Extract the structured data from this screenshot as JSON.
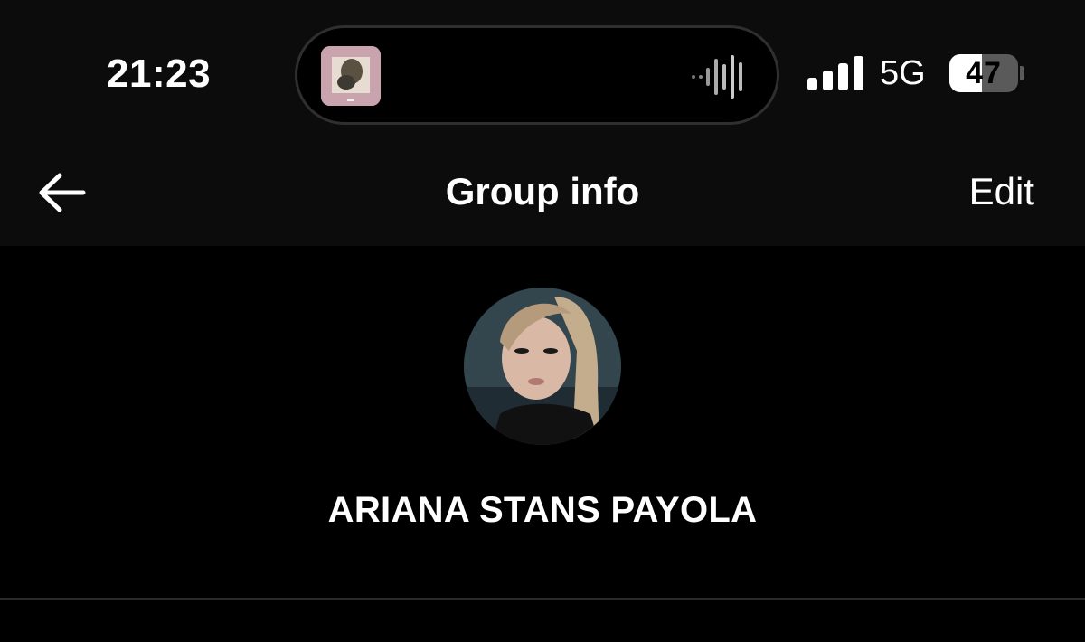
{
  "status_bar": {
    "time": "21:23",
    "network": "5G",
    "battery_level": "47",
    "battery_fraction": 0.47,
    "signal_bars": 4
  },
  "header": {
    "title": "Group info",
    "edit_label": "Edit",
    "back_icon": "arrow-left-icon"
  },
  "group": {
    "name": "ARIANA STANS PAYOLA"
  },
  "colors": {
    "background": "#000000",
    "header_background": "#0c0c0c",
    "text": "#ffffff",
    "divider": "#2a2a2a"
  }
}
